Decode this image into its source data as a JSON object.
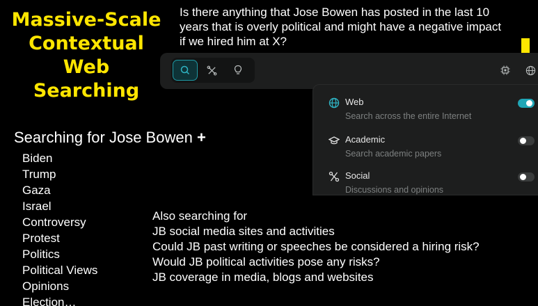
{
  "title": "Massive-Scale Contextual Web Searching",
  "query": "Is there anything that Jose Bowen has posted in the last 10 years that is overly political and might have a negative impact if we hired him at  X?",
  "search_bar": {
    "modes": [
      "search-icon",
      "focus-icon",
      "lightbulb-icon"
    ],
    "right_icons": [
      "chip-icon",
      "globe-icon"
    ]
  },
  "sources": [
    {
      "icon": "globe-icon",
      "name": "Web",
      "desc": "Search across the entire Internet",
      "enabled": true
    },
    {
      "icon": "graduation-cap-icon",
      "name": "Academic",
      "desc": "Search academic papers",
      "enabled": false
    },
    {
      "icon": "social-icon",
      "name": "Social",
      "desc": "Discussions and opinions",
      "enabled": false
    }
  ],
  "colors": {
    "title": "#ffe600",
    "accent": "#20a6b6",
    "arrow": "#ffe600"
  },
  "heading": {
    "text": "Searching for Jose Bowen ",
    "plus": "+"
  },
  "terms": [
    "Biden",
    "Trump",
    "Gaza",
    "Israel",
    "Controversy",
    "Protest",
    "Politics",
    "Political Views",
    "Opinions",
    "Election…"
  ],
  "also": {
    "label": "Also searching for",
    "items": [
      "JB social media sites and activities",
      "Could JB past writing or speeches be considered a hiring risk?",
      "Would JB political activities pose any risks?",
      "JB coverage in media, blogs and websites"
    ]
  }
}
